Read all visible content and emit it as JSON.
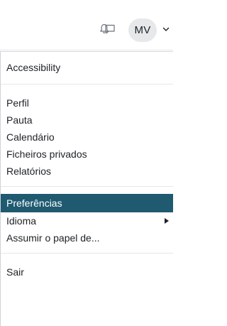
{
  "navbar": {
    "icons": {
      "notifications": "bell-icon",
      "messages": "chat-bubble-icon",
      "user_menu_toggle": "chevron-down-icon"
    },
    "avatar_initials": "MV"
  },
  "user_menu": {
    "items": [
      {
        "label": "Accessibility"
      },
      {
        "label": "Perfil"
      },
      {
        "label": "Pauta"
      },
      {
        "label": "Calendário"
      },
      {
        "label": "Ficheiros privados"
      },
      {
        "label": "Relatórios"
      },
      {
        "label": "Preferências",
        "state": "highlighted"
      },
      {
        "label": "Idioma",
        "has_submenu": true
      },
      {
        "label": "Assumir o papel de..."
      },
      {
        "label": "Sair"
      }
    ]
  },
  "colors": {
    "highlight": "#1f5a70",
    "text": "#1d2125",
    "avatar_bg": "#e7e8ea"
  }
}
